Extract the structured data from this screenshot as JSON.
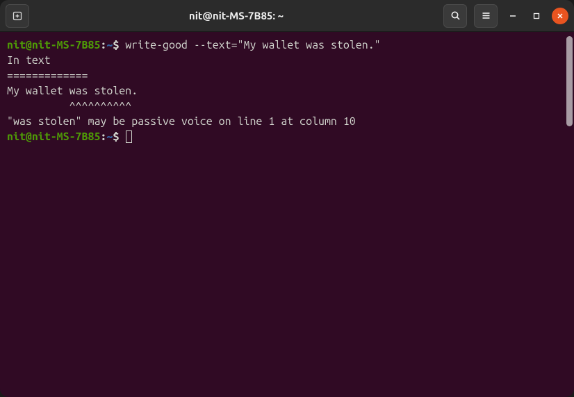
{
  "titlebar": {
    "title": "nit@nit-MS-7B85: ~"
  },
  "terminal": {
    "prompt_user_host": "nit@nit-MS-7B85",
    "prompt_colon": ":",
    "prompt_path": "~",
    "prompt_dollar": "$ ",
    "command1": "write-good --text=\"My wallet was stolen.\"",
    "output_line1": "In text",
    "output_line2": "=============",
    "output_line3": "My wallet was stolen.",
    "output_line4": "          ^^^^^^^^^^",
    "output_line5": "\"was stolen\" may be passive voice on line 1 at column 10"
  }
}
